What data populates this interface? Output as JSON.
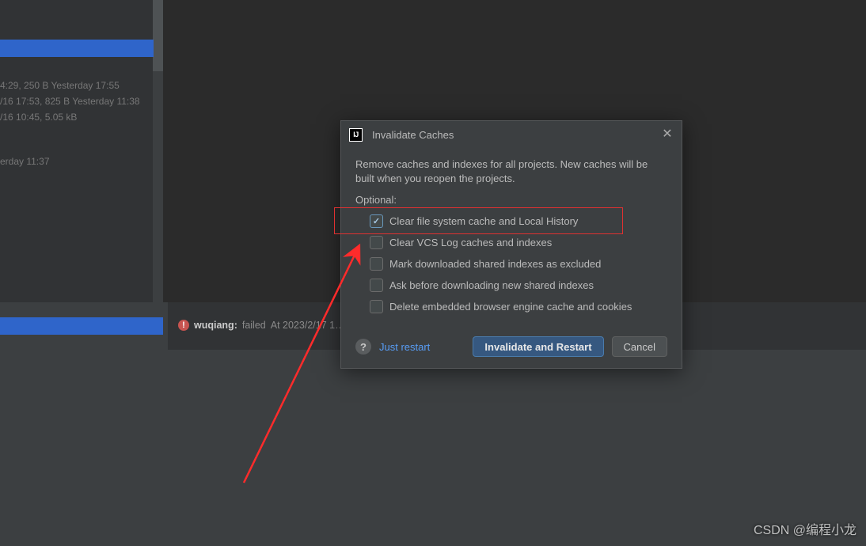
{
  "left_panel": {
    "file_lines": [
      "4:29, 250 B Yesterday 17:55",
      "/16 17:53, 825 B Yesterday 11:38",
      "/16 10:45, 5.05 kB"
    ],
    "extra_line": "erday 11:37"
  },
  "status": {
    "user": "wuqiang:",
    "state": "failed",
    "time": "At 2023/2/17 1…"
  },
  "dialog": {
    "title": "Invalidate Caches",
    "description": "Remove caches and indexes for all projects. New caches will be built when you reopen the projects.",
    "optional_label": "Optional:",
    "options": [
      {
        "label": "Clear file system cache and Local History",
        "checked": true
      },
      {
        "label": "Clear VCS Log caches and indexes",
        "checked": false
      },
      {
        "label": "Mark downloaded shared indexes as excluded",
        "checked": false
      },
      {
        "label": "Ask before downloading new shared indexes",
        "checked": false
      },
      {
        "label": "Delete embedded browser engine cache and cookies",
        "checked": false
      }
    ],
    "just_restart": "Just restart",
    "invalidate_button": "Invalidate and Restart",
    "cancel_button": "Cancel"
  },
  "watermark": "CSDN @编程小龙"
}
